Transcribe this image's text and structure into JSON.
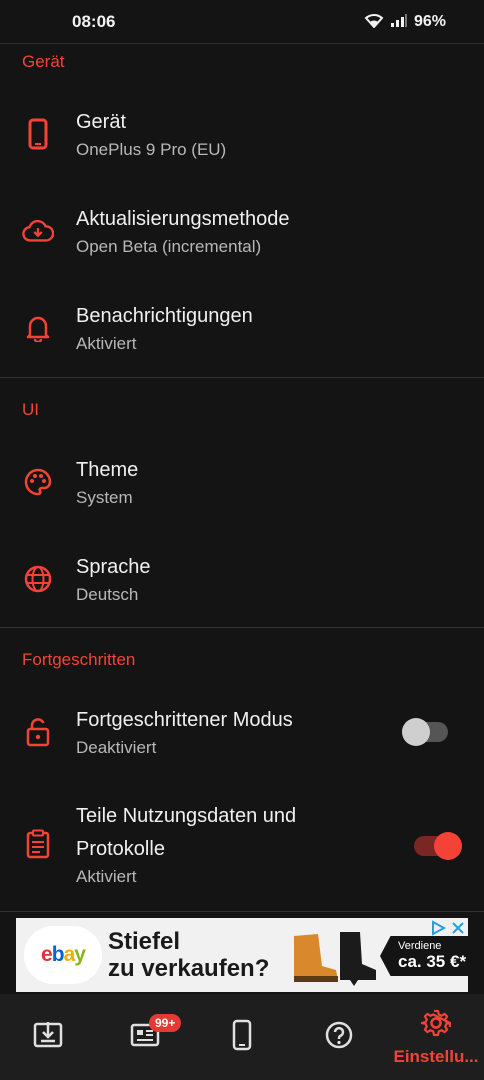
{
  "status_bar": {
    "time": "08:06",
    "battery": "96%"
  },
  "sections": [
    {
      "title": "Gerät",
      "items": [
        {
          "title": "Gerät",
          "subtitle": "OnePlus 9 Pro (EU)",
          "icon": "phone-icon"
        },
        {
          "title": "Aktualisierungsmethode",
          "subtitle": "Open Beta (incremental)",
          "icon": "cloud-download-icon"
        },
        {
          "title": "Benachrichtigungen",
          "subtitle": "Aktiviert",
          "icon": "bell-icon"
        }
      ]
    },
    {
      "title": "UI",
      "items": [
        {
          "title": "Theme",
          "subtitle": "System",
          "icon": "palette-icon"
        },
        {
          "title": "Sprache",
          "subtitle": "Deutsch",
          "icon": "globe-icon"
        }
      ]
    },
    {
      "title": "Fortgeschritten",
      "items": [
        {
          "title": "Fortgeschrittener Modus",
          "subtitle": "Deaktiviert",
          "icon": "lock-icon",
          "toggle": false
        },
        {
          "title_line1": "Teile Nutzungsdaten und",
          "title_line2": "Protokolle",
          "subtitle": "Aktiviert",
          "icon": "clipboard-icon",
          "toggle": true
        }
      ]
    }
  ],
  "ad": {
    "brand": "ebay",
    "headline_line1": "Stiefel",
    "headline_line2": "zu verkaufen?",
    "promo_line1": "Verdiene",
    "promo_line2": "ca. 35 €*"
  },
  "bottom_nav": {
    "items": [
      {
        "icon": "download-icon"
      },
      {
        "icon": "news-icon",
        "badge": "99+"
      },
      {
        "icon": "device-icon"
      },
      {
        "icon": "help-icon"
      },
      {
        "icon": "settings-icon",
        "label": "Einstellu...",
        "active": true
      }
    ]
  },
  "colors": {
    "accent": "#f44336",
    "background": "#141414",
    "nav_background": "#1e1e1e"
  }
}
